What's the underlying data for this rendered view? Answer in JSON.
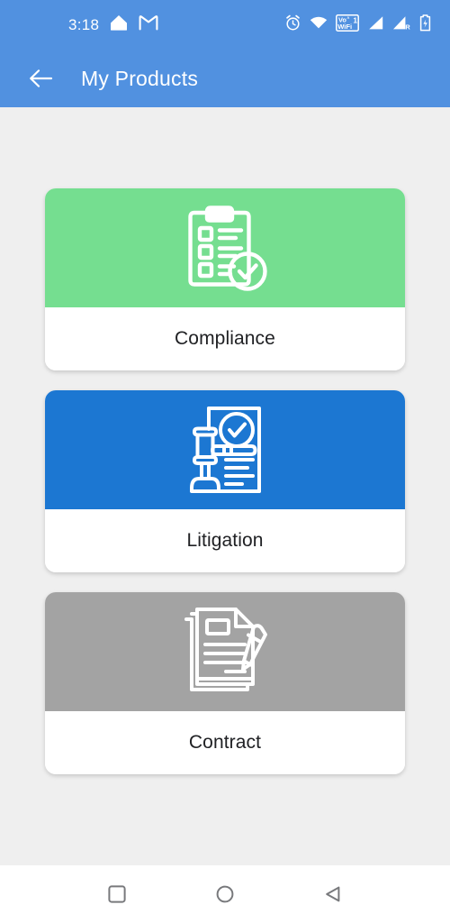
{
  "status_bar": {
    "clock": "3:18",
    "left_icons": [
      {
        "name": "home-assistant-icon",
        "label": "home"
      },
      {
        "name": "gmail-icon",
        "label": "M"
      }
    ],
    "right_icons": [
      {
        "name": "alarm-icon",
        "label": "alarm"
      },
      {
        "name": "wifi-icon",
        "label": "wifi"
      },
      {
        "name": "volte-wifi-calling-icon",
        "label": "VoWiFi1"
      },
      {
        "name": "signal-bars-icon",
        "label": "signal"
      },
      {
        "name": "signal-roaming-icon",
        "label": "signal R"
      },
      {
        "name": "battery-icon",
        "label": "battery"
      }
    ],
    "vowifi_line1": "Vo",
    "vowifi_sup": "ʌ",
    "vowifi_line2": "WiFi",
    "vowifi_sim": "1",
    "roaming_letter": "R"
  },
  "app_bar": {
    "back_label": "Back",
    "title": "My Products"
  },
  "colors": {
    "app_bar": "#5191e0",
    "background": "#efefef",
    "card_surface": "#ffffff",
    "compliance": "#75de90",
    "litigation": "#1c77d2",
    "contract": "#a3a3a3",
    "label_text": "#202124",
    "icon_stroke": "#ffffff",
    "nav_bar": "#ffffff",
    "nav_icon": "#78797c"
  },
  "products": [
    {
      "id": "compliance",
      "label": "Compliance",
      "banner_color": "#75de90",
      "icon": "clipboard-check-icon"
    },
    {
      "id": "litigation",
      "label": "Litigation",
      "banner_color": "#1c77d2",
      "icon": "gavel-document-check-icon"
    },
    {
      "id": "contract",
      "label": "Contract",
      "banner_color": "#a3a3a3",
      "icon": "documents-pen-icon"
    }
  ],
  "nav_bar": {
    "buttons": [
      {
        "name": "recents-button",
        "label": "Recents"
      },
      {
        "name": "home-button",
        "label": "Home"
      },
      {
        "name": "back-button",
        "label": "Back"
      }
    ]
  }
}
